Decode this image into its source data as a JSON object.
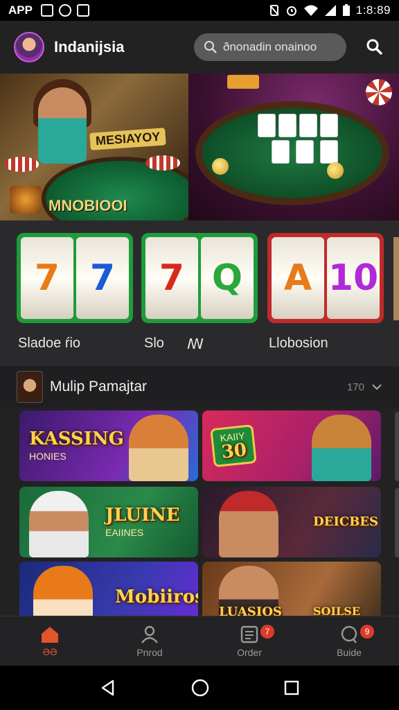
{
  "status_bar": {
    "app_label": "APP",
    "time": "1:8:89",
    "icons": [
      "gallery-icon",
      "shield-icon",
      "image-icon",
      "no-sim-icon",
      "alarm-icon",
      "wifi-icon",
      "signal-icon",
      "battery-icon"
    ]
  },
  "header": {
    "title": "Indanijsia",
    "search_placeholder": "ðnonadin onainoo"
  },
  "banner": {
    "left_sign": "MESIAYOY",
    "caption": "MNOBIOOI"
  },
  "slots": [
    {
      "label": "Sladoe ŕio",
      "reels": [
        "7",
        "7"
      ],
      "color": "#1f9c3a"
    },
    {
      "label": "Slo",
      "reels": [
        "7",
        "Q"
      ],
      "color": "#1f9c3a"
    },
    {
      "label": "Llobosion",
      "reels": [
        "A",
        "10"
      ],
      "color": "#c02a2a"
    }
  ],
  "slot_extra_mark": "ꟿ",
  "section": {
    "title": "Mulip Pamajtar",
    "count": "170"
  },
  "games": [
    {
      "title": "KASSING",
      "subtitle": "HONIES"
    },
    {
      "title": "30",
      "subtitle": "KAIIY"
    },
    {
      "title": "JLUINE",
      "subtitle": "EAIINES"
    },
    {
      "title": "DEICBES",
      "subtitle": ""
    },
    {
      "title": "Mobiiros",
      "subtitle": ""
    },
    {
      "title": "LUASIOS",
      "subtitle": "SOILSE"
    }
  ],
  "bottom_nav": [
    {
      "label": "ƏƏ",
      "icon": "home-icon",
      "active": true,
      "badge": ""
    },
    {
      "label": "Pnrod",
      "icon": "profile-icon",
      "active": false,
      "badge": ""
    },
    {
      "label": "Order",
      "icon": "order-icon",
      "active": false,
      "badge": "7"
    },
    {
      "label": "Buide",
      "icon": "chat-icon",
      "active": false,
      "badge": "9"
    }
  ],
  "colors": {
    "accent": "#e0552b",
    "background": "#1d1d1f",
    "badge": "#e03a2a"
  }
}
